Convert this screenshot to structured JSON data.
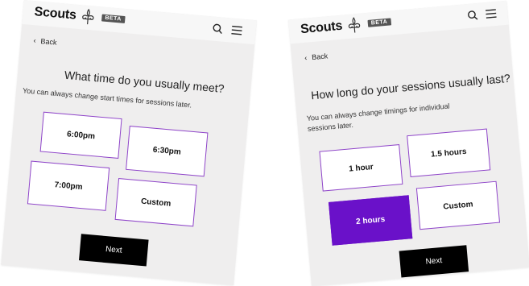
{
  "brand": {
    "name": "Scouts",
    "badge": "BETA"
  },
  "colors": {
    "accent": "#6a11c9",
    "border": "#8e44c8",
    "next_button": "#000000"
  },
  "icons": {
    "logo": "fleur-de-lis-icon",
    "search": "search-icon",
    "menu": "hamburger-menu-icon",
    "back": "chevron-left-icon"
  },
  "screens": [
    {
      "back_label": "Back",
      "question": "What time do you usually meet?",
      "hint": "You can always change start times for sessions later.",
      "options": [
        {
          "label": "6:00pm",
          "selected": false
        },
        {
          "label": "6:30pm",
          "selected": false
        },
        {
          "label": "7:00pm",
          "selected": false
        },
        {
          "label": "Custom",
          "selected": false
        }
      ],
      "next_label": "Next"
    },
    {
      "back_label": "Back",
      "question": "How long do your sessions usually last?",
      "hint": "You can always change timings for individual sessions later.",
      "options": [
        {
          "label": "1 hour",
          "selected": false
        },
        {
          "label": "1.5 hours",
          "selected": false
        },
        {
          "label": "2 hours",
          "selected": true
        },
        {
          "label": "Custom",
          "selected": false
        }
      ],
      "next_label": "Next"
    }
  ]
}
